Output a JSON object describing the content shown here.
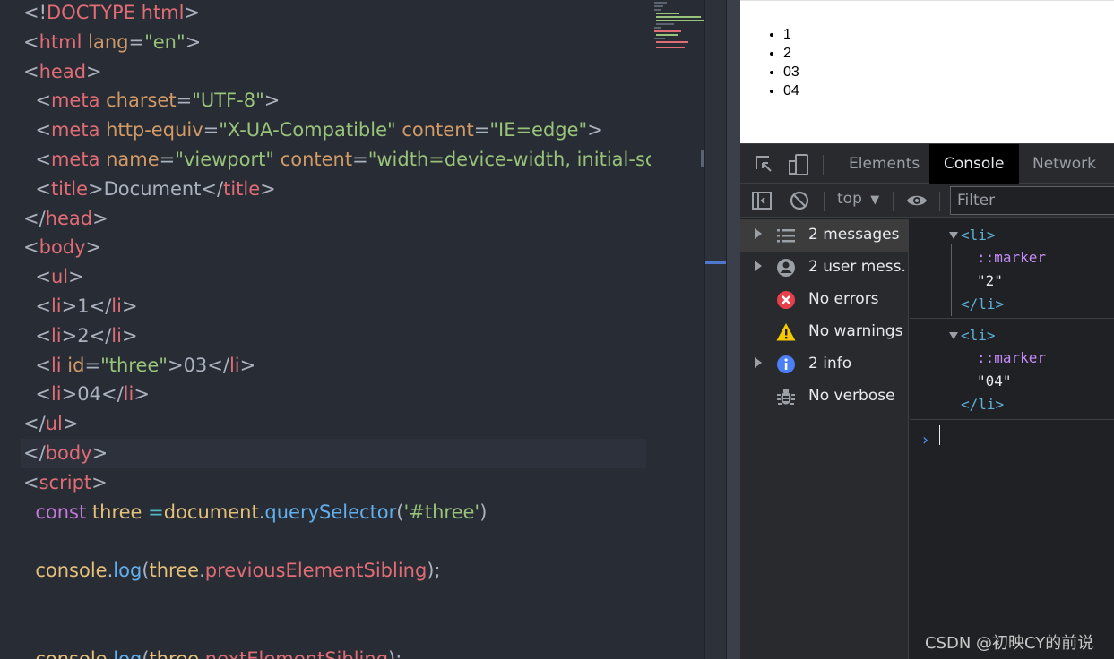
{
  "editor": {
    "lines": [
      [
        [
          "p",
          "<!"
        ],
        [
          "t",
          "DOCTYPE html"
        ],
        [
          "p",
          ">"
        ]
      ],
      [
        [
          "p",
          "<"
        ],
        [
          "t",
          "html"
        ],
        [
          "a",
          " lang"
        ],
        [
          "p",
          "="
        ],
        [
          "s",
          "\"en\""
        ],
        [
          "p",
          ">"
        ]
      ],
      [
        [
          "p",
          "<"
        ],
        [
          "t",
          "head"
        ],
        [
          "p",
          ">"
        ]
      ],
      [
        [
          "p",
          "  <"
        ],
        [
          "t",
          "meta"
        ],
        [
          "a",
          " charset"
        ],
        [
          "p",
          "="
        ],
        [
          "s",
          "\"UTF-8\""
        ],
        [
          "p",
          ">"
        ]
      ],
      [
        [
          "p",
          "  <"
        ],
        [
          "t",
          "meta"
        ],
        [
          "a",
          " http-equiv"
        ],
        [
          "p",
          "="
        ],
        [
          "s",
          "\"X-UA-Compatible\""
        ],
        [
          "a",
          " content"
        ],
        [
          "p",
          "="
        ],
        [
          "s",
          "\"IE=edge\""
        ],
        [
          "p",
          ">"
        ]
      ],
      [
        [
          "p",
          "  <"
        ],
        [
          "t",
          "meta"
        ],
        [
          "a",
          " name"
        ],
        [
          "p",
          "="
        ],
        [
          "s",
          "\"viewport\""
        ],
        [
          "a",
          " content"
        ],
        [
          "p",
          "="
        ],
        [
          "s",
          "\"width=device-width, initial-sc"
        ]
      ],
      [
        [
          "p",
          "  <"
        ],
        [
          "t",
          "title"
        ],
        [
          "p",
          ">"
        ],
        [
          "tx",
          "Document"
        ],
        [
          "p",
          "</"
        ],
        [
          "t",
          "title"
        ],
        [
          "p",
          ">"
        ]
      ],
      [
        [
          "p",
          "</"
        ],
        [
          "t",
          "head"
        ],
        [
          "p",
          ">"
        ]
      ],
      [
        [
          "p",
          "<"
        ],
        [
          "t",
          "body"
        ],
        [
          "p",
          ">"
        ]
      ],
      [
        [
          "p",
          "  <"
        ],
        [
          "t",
          "ul"
        ],
        [
          "p",
          ">"
        ]
      ],
      [
        [
          "p",
          "  <"
        ],
        [
          "t",
          "li"
        ],
        [
          "p",
          ">"
        ],
        [
          "tx",
          "1"
        ],
        [
          "p",
          "</"
        ],
        [
          "t",
          "li"
        ],
        [
          "p",
          ">"
        ]
      ],
      [
        [
          "p",
          "  <"
        ],
        [
          "t",
          "li"
        ],
        [
          "p",
          ">"
        ],
        [
          "tx",
          "2"
        ],
        [
          "p",
          "</"
        ],
        [
          "t",
          "li"
        ],
        [
          "p",
          ">"
        ]
      ],
      [
        [
          "p",
          "  <"
        ],
        [
          "t",
          "li"
        ],
        [
          "a",
          " id"
        ],
        [
          "p",
          "="
        ],
        [
          "s",
          "\"three\""
        ],
        [
          "p",
          ">"
        ],
        [
          "tx",
          "03"
        ],
        [
          "p",
          "</"
        ],
        [
          "t",
          "li"
        ],
        [
          "p",
          ">"
        ]
      ],
      [
        [
          "p",
          "  <"
        ],
        [
          "t",
          "li"
        ],
        [
          "p",
          ">"
        ],
        [
          "tx",
          "04"
        ],
        [
          "p",
          "</"
        ],
        [
          "t",
          "li"
        ],
        [
          "p",
          ">"
        ]
      ],
      [
        [
          "p",
          "</"
        ],
        [
          "t",
          "ul"
        ],
        [
          "p",
          ">"
        ]
      ],
      [
        [
          "p",
          "</"
        ],
        [
          "t",
          "body"
        ],
        [
          "p",
          ">"
        ]
      ],
      [
        [
          "p",
          "<"
        ],
        [
          "t",
          "script"
        ],
        [
          "p",
          ">"
        ]
      ],
      [
        [
          "k",
          "  const"
        ],
        [
          "v",
          " three"
        ],
        [
          "o",
          " ="
        ],
        [
          "v",
          "document"
        ],
        [
          "p",
          "."
        ],
        [
          "f",
          "querySelector"
        ],
        [
          "p",
          "("
        ],
        [
          "s",
          "'#three'"
        ],
        [
          "p",
          ")"
        ]
      ],
      [],
      [
        [
          "v",
          "  console"
        ],
        [
          "p",
          "."
        ],
        [
          "f",
          "log"
        ],
        [
          "p",
          "("
        ],
        [
          "v",
          "three"
        ],
        [
          "p",
          "."
        ],
        [
          "t",
          "previousElementSibling"
        ],
        [
          "p",
          ");"
        ]
      ],
      [],
      [],
      [
        [
          "v",
          "  console"
        ],
        [
          "p",
          "."
        ],
        [
          "f",
          "log"
        ],
        [
          "p",
          "("
        ],
        [
          "v",
          "three"
        ],
        [
          "p",
          "."
        ],
        [
          "t",
          "nextElementSibling"
        ],
        [
          "p",
          ");"
        ]
      ]
    ],
    "highlighted_line": 15
  },
  "preview": {
    "items": [
      "1",
      "2",
      "03",
      "04"
    ]
  },
  "devtools": {
    "tabs": [
      "Elements",
      "Console",
      "Network"
    ],
    "active_tab": "Console",
    "context": "top",
    "filter_placeholder": "Filter",
    "sidebar": [
      {
        "label": "2 messages",
        "icon": "list-icon",
        "expandable": true,
        "selected": true
      },
      {
        "label": "2 user mess…",
        "icon": "user-icon",
        "expandable": true,
        "selected": false
      },
      {
        "label": "No errors",
        "icon": "error-icon",
        "expandable": false,
        "selected": false
      },
      {
        "label": "No warnings",
        "icon": "warning-icon",
        "expandable": false,
        "selected": false
      },
      {
        "label": "2 info",
        "icon": "info-icon",
        "expandable": true,
        "selected": false
      },
      {
        "label": "No verbose",
        "icon": "bug-icon",
        "expandable": false,
        "selected": false
      }
    ],
    "console": {
      "messages": [
        {
          "open_tag": "<li>",
          "pseudo": "::marker",
          "text": "\"2\"",
          "close_tag": "</li>"
        },
        {
          "open_tag": "<li>",
          "pseudo": "::marker",
          "text": "\"04\"",
          "close_tag": "</li>"
        }
      ],
      "prompt": "›"
    },
    "colors": {
      "error": "#e8404b",
      "warning": "#f7c800",
      "info": "#4a7ff5"
    }
  },
  "watermark": "CSDN @初映CY的前说"
}
